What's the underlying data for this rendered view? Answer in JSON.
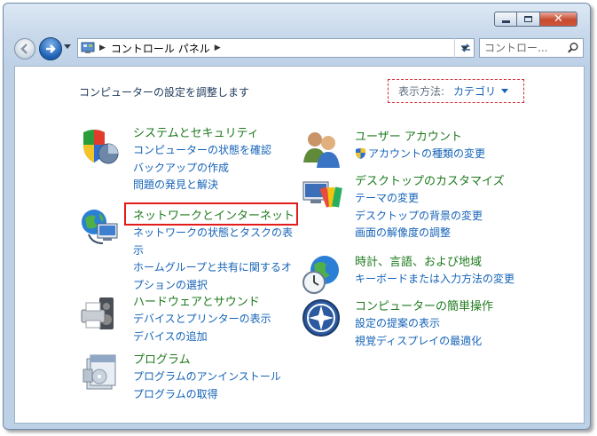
{
  "window": {
    "controls": {
      "minimize": "minimize-icon",
      "maximize": "maximize-icon",
      "close": "close-icon"
    },
    "close_color": "#c74a2f"
  },
  "nav": {
    "address": "コントロール パネル",
    "search_placeholder": "コントロー..."
  },
  "header": {
    "title": "コンピューターの設定を調整します",
    "view_by_label": "表示方法:",
    "view_by_value": "カテゴリ"
  },
  "categories": [
    {
      "title": "システムとセキュリティ",
      "links": [
        "コンピューターの状態を確認",
        "バックアップの作成",
        "問題の発見と解決"
      ]
    },
    {
      "title": "ネットワークとインターネット",
      "links": [
        "ネットワークの状態とタスクの表示",
        "ホームグループと共有に関するオプションの選択"
      ]
    },
    {
      "title": "ハードウェアとサウンド",
      "links": [
        "デバイスとプリンターの表示",
        "デバイスの追加"
      ]
    },
    {
      "title": "プログラム",
      "links": [
        "プログラムのアンインストール",
        "プログラムの取得"
      ]
    },
    {
      "title": "ユーザー アカウント",
      "links": [
        "アカウントの種類の変更"
      ]
    },
    {
      "title": "デスクトップのカスタマイズ",
      "links": [
        "テーマの変更",
        "デスクトップの背景の変更",
        "画面の解像度の調整"
      ]
    },
    {
      "title": "時計、言語、および地域",
      "links": [
        "キーボードまたは入力方法の変更"
      ]
    },
    {
      "title": "コンピューターの簡単操作",
      "links": [
        "設定の提案の表示",
        "視覚ディスプレイの最適化"
      ]
    }
  ],
  "colors": {
    "link": "#1563b7",
    "category_title": "#1e7a1e",
    "highlight": "#e21b1b",
    "dashed_box": "#d0303a"
  }
}
